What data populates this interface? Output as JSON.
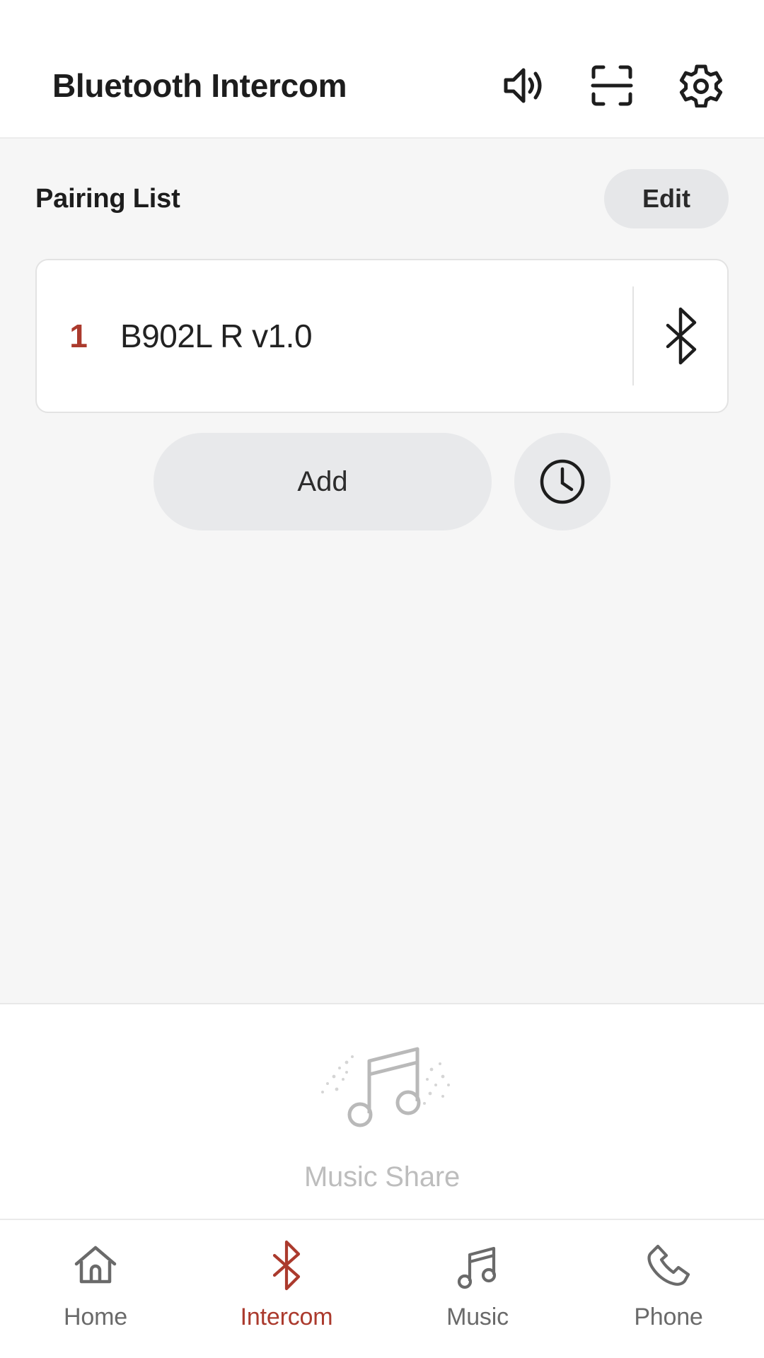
{
  "header": {
    "title": "Bluetooth Intercom",
    "actions": [
      {
        "icon": "speaker-volume-icon",
        "name": "volume"
      },
      {
        "icon": "qr-scan-icon",
        "name": "scan"
      },
      {
        "icon": "gear-icon",
        "name": "settings"
      }
    ]
  },
  "pairing": {
    "section_title": "Pairing List",
    "edit_label": "Edit",
    "devices": [
      {
        "index": "1",
        "name": "B902L R v1.0",
        "status_icon": "bluetooth-icon"
      }
    ],
    "add_label": "Add",
    "history_icon": "clock-history-icon"
  },
  "music_share": {
    "label": "Music Share",
    "icon": "music-note-sparkle-icon"
  },
  "tabbar": {
    "items": [
      {
        "label": "Home",
        "icon": "home-icon",
        "active": false
      },
      {
        "label": "Intercom",
        "icon": "bluetooth-icon",
        "active": true
      },
      {
        "label": "Music",
        "icon": "music-note-icon",
        "active": false
      },
      {
        "label": "Phone",
        "icon": "phone-handset-icon",
        "active": false
      }
    ]
  },
  "colors": {
    "accent_red": "#ab3a2d",
    "content_bg": "#f6f6f6",
    "panel_bg": "#ffffff",
    "pill_bg": "#e8e9eb",
    "muted_text": "#bdbdbd",
    "tab_inactive": "#6a6a6a",
    "text_primary": "#1d1d1d"
  }
}
